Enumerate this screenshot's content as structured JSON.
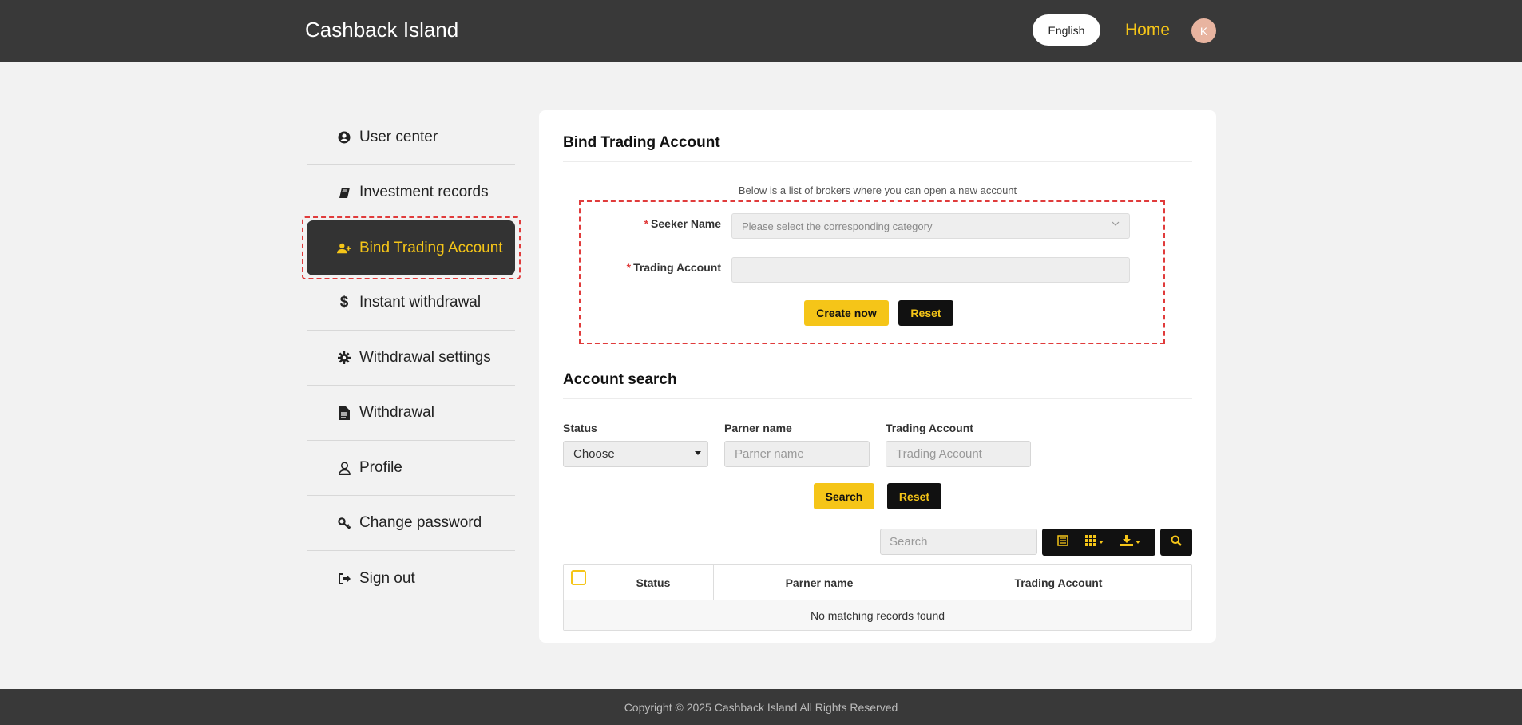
{
  "header": {
    "brand": "Cashback Island",
    "language": "English",
    "home": "Home",
    "avatar_letter": "K"
  },
  "sidebar": {
    "items": [
      {
        "label": "User center",
        "icon": "user-circle-icon"
      },
      {
        "label": "Investment records",
        "icon": "book-icon"
      },
      {
        "label": "Bind Trading Account",
        "icon": "user-plus-icon",
        "active": true
      },
      {
        "label": "Instant withdrawal",
        "icon": "dollar-icon"
      },
      {
        "label": "Withdrawal settings",
        "icon": "gear-icon"
      },
      {
        "label": "Withdrawal",
        "icon": "document-icon"
      },
      {
        "label": "Profile",
        "icon": "user-outline-icon"
      },
      {
        "label": "Change password",
        "icon": "key-icon"
      },
      {
        "label": "Sign out",
        "icon": "sign-out-icon"
      }
    ]
  },
  "bind": {
    "title": "Bind Trading Account",
    "intro": "Below is a list of brokers where you can open a new account",
    "seeker_label": "Seeker Name",
    "seeker_placeholder": "Please select the corresponding category",
    "account_label": "Trading Account",
    "account_value": "",
    "create_label": "Create now",
    "reset_label": "Reset",
    "required_mark": "*"
  },
  "search": {
    "title": "Account search",
    "status_label": "Status",
    "status_value": "Choose",
    "partner_label": "Parner name",
    "partner_placeholder": "Parner name",
    "trading_label": "Trading Account",
    "trading_placeholder": "Trading Account",
    "search_label": "Search",
    "reset_label": "Reset",
    "toolbar_search_placeholder": "Search"
  },
  "table": {
    "columns": [
      "Status",
      "Parner name",
      "Trading Account"
    ],
    "empty_message": "No matching records found"
  },
  "footer": {
    "copyright": "Copyright © 2025 Cashback Island All Rights Reserved"
  },
  "colors": {
    "accent": "#f5c518",
    "header_bg": "#393939",
    "highlight": "#e03b3b"
  }
}
